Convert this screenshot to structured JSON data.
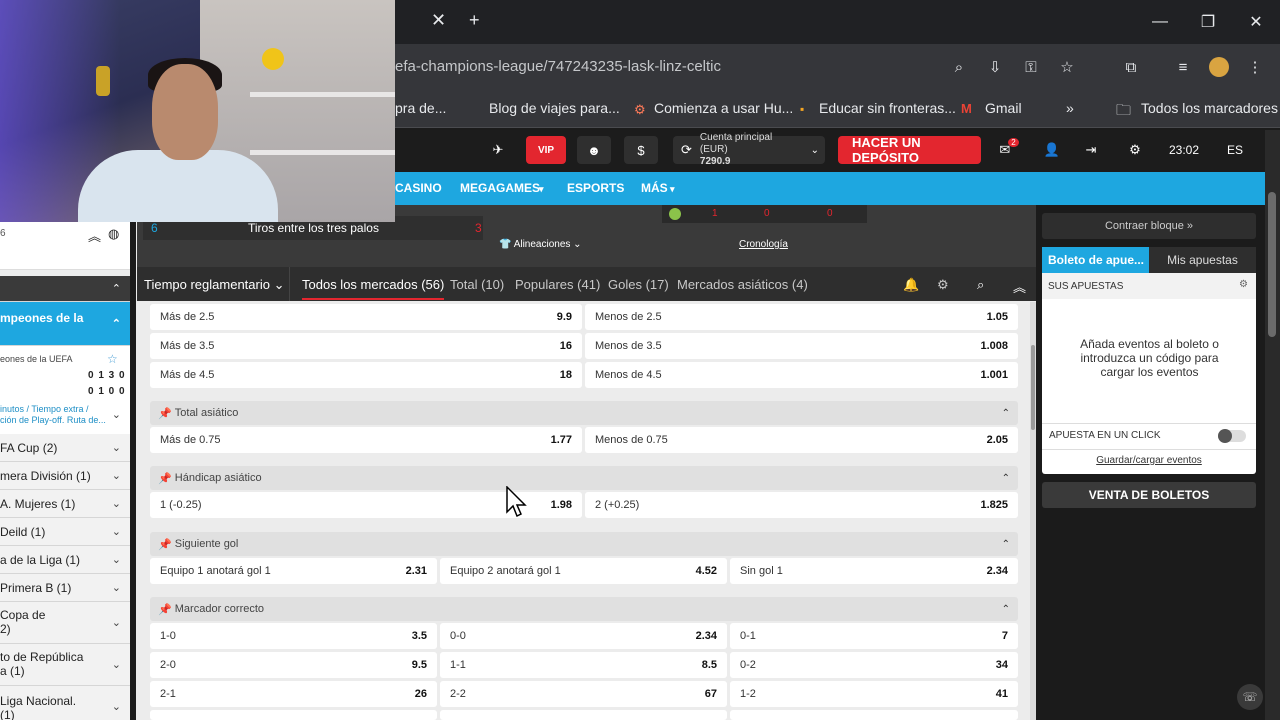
{
  "browser": {
    "url": "efa-champions-league/747243235-lask-linz-celtic",
    "bookmarks": [
      "pra de...",
      "Blog de viajes para...",
      "Comienza a usar Hu...",
      "Educar sin fronteras...",
      "Gmail",
      "Todos los marcadores"
    ]
  },
  "header": {
    "vip_label": "VIP",
    "account_label": "Cuenta principal (EUR)",
    "account_balance": "7290.9",
    "deposit_label": "HACER UN DEPÓSITO",
    "mail_badge": "2",
    "time": "23:02",
    "language": "ES"
  },
  "nav": [
    "CASINO",
    "MEGAGAMES",
    "ESPORTS",
    "MÁS"
  ],
  "match": {
    "stat_left": "6",
    "stat_label": "Tiros entre los tres palos",
    "stat_right": "3",
    "lineups_label": "Alineaciones",
    "timeline_label": "Cronología",
    "scores": [
      "1",
      "0",
      "0"
    ]
  },
  "left_sidebar": {
    "top_small": "6",
    "section_header": "",
    "active_title": "mpeones de la",
    "league_name": "eones de la UEFA",
    "score_row1": "0 1 3 0",
    "score_row2": "0 1 0 0",
    "match_note": "inutos / Tiempo extra / ción de Play-off. Ruta de...",
    "items": [
      "FA Cup (2)",
      "mera División (1)",
      "A. Mujeres (1)",
      "Deild (1)",
      "a de la Liga (1)",
      "Primera B (1)",
      "Copa de\n2)",
      "to de República\na (1)",
      "Liga Nacional.\n(1)"
    ]
  },
  "tabs": {
    "period": "Tiempo reglamentario",
    "items": [
      "Todos los mercados (56)",
      "Total (10)",
      "Populares (41)",
      "Goles (17)",
      "Mercados asiáticos (4)"
    ]
  },
  "markets": {
    "total_rows": [
      {
        "l_label": "Más de 2.5",
        "l_odd": "9.9",
        "r_label": "Menos de 2.5",
        "r_odd": "1.05"
      },
      {
        "l_label": "Más de 3.5",
        "l_odd": "16",
        "r_label": "Menos de 3.5",
        "r_odd": "1.008"
      },
      {
        "l_label": "Más de 4.5",
        "l_odd": "18",
        "r_label": "Menos de 4.5",
        "r_odd": "1.001"
      }
    ],
    "asian_total": {
      "title": "Total asiático",
      "l_label": "Más de 0.75",
      "l_odd": "1.77",
      "r_label": "Menos de 0.75",
      "r_odd": "2.05"
    },
    "asian_handicap": {
      "title": "Hándicap asiático",
      "l_label": "1 (-0.25)",
      "l_odd": "1.98",
      "r_label": "2 (+0.25)",
      "r_odd": "1.825"
    },
    "next_goal": {
      "title": "Siguiente gol",
      "cells": [
        {
          "label": "Equipo 1 anotará gol 1",
          "odd": "2.31"
        },
        {
          "label": "Equipo 2 anotará gol 1",
          "odd": "4.52"
        },
        {
          "label": "Sin gol 1",
          "odd": "2.34"
        }
      ]
    },
    "correct_score": {
      "title": "Marcador correcto",
      "rows": [
        [
          {
            "label": "1-0",
            "odd": "3.5"
          },
          {
            "label": "0-0",
            "odd": "2.34"
          },
          {
            "label": "0-1",
            "odd": "7"
          }
        ],
        [
          {
            "label": "2-0",
            "odd": "9.5"
          },
          {
            "label": "1-1",
            "odd": "8.5"
          },
          {
            "label": "0-2",
            "odd": "34"
          }
        ],
        [
          {
            "label": "2-1",
            "odd": "26"
          },
          {
            "label": "2-2",
            "odd": "67"
          },
          {
            "label": "1-2",
            "odd": "41"
          }
        ]
      ]
    }
  },
  "betslip": {
    "contract_label": "Contraer bloque",
    "tab_active": "Boleto de apue...",
    "tab_other": "Mis apuestas",
    "your_bets": "SUS APUESTAS",
    "empty_text": "Añada eventos al boleto o introduzca un código para cargar los eventos",
    "one_click": "APUESTA EN UN CLICK",
    "save_load": "Guardar/cargar eventos",
    "sale_button": "VENTA DE BOLETOS"
  },
  "colors": {
    "accent_red": "#e3262f",
    "nav_blue": "#1ea7e0",
    "sidebar_active": "#1ea7e0"
  }
}
